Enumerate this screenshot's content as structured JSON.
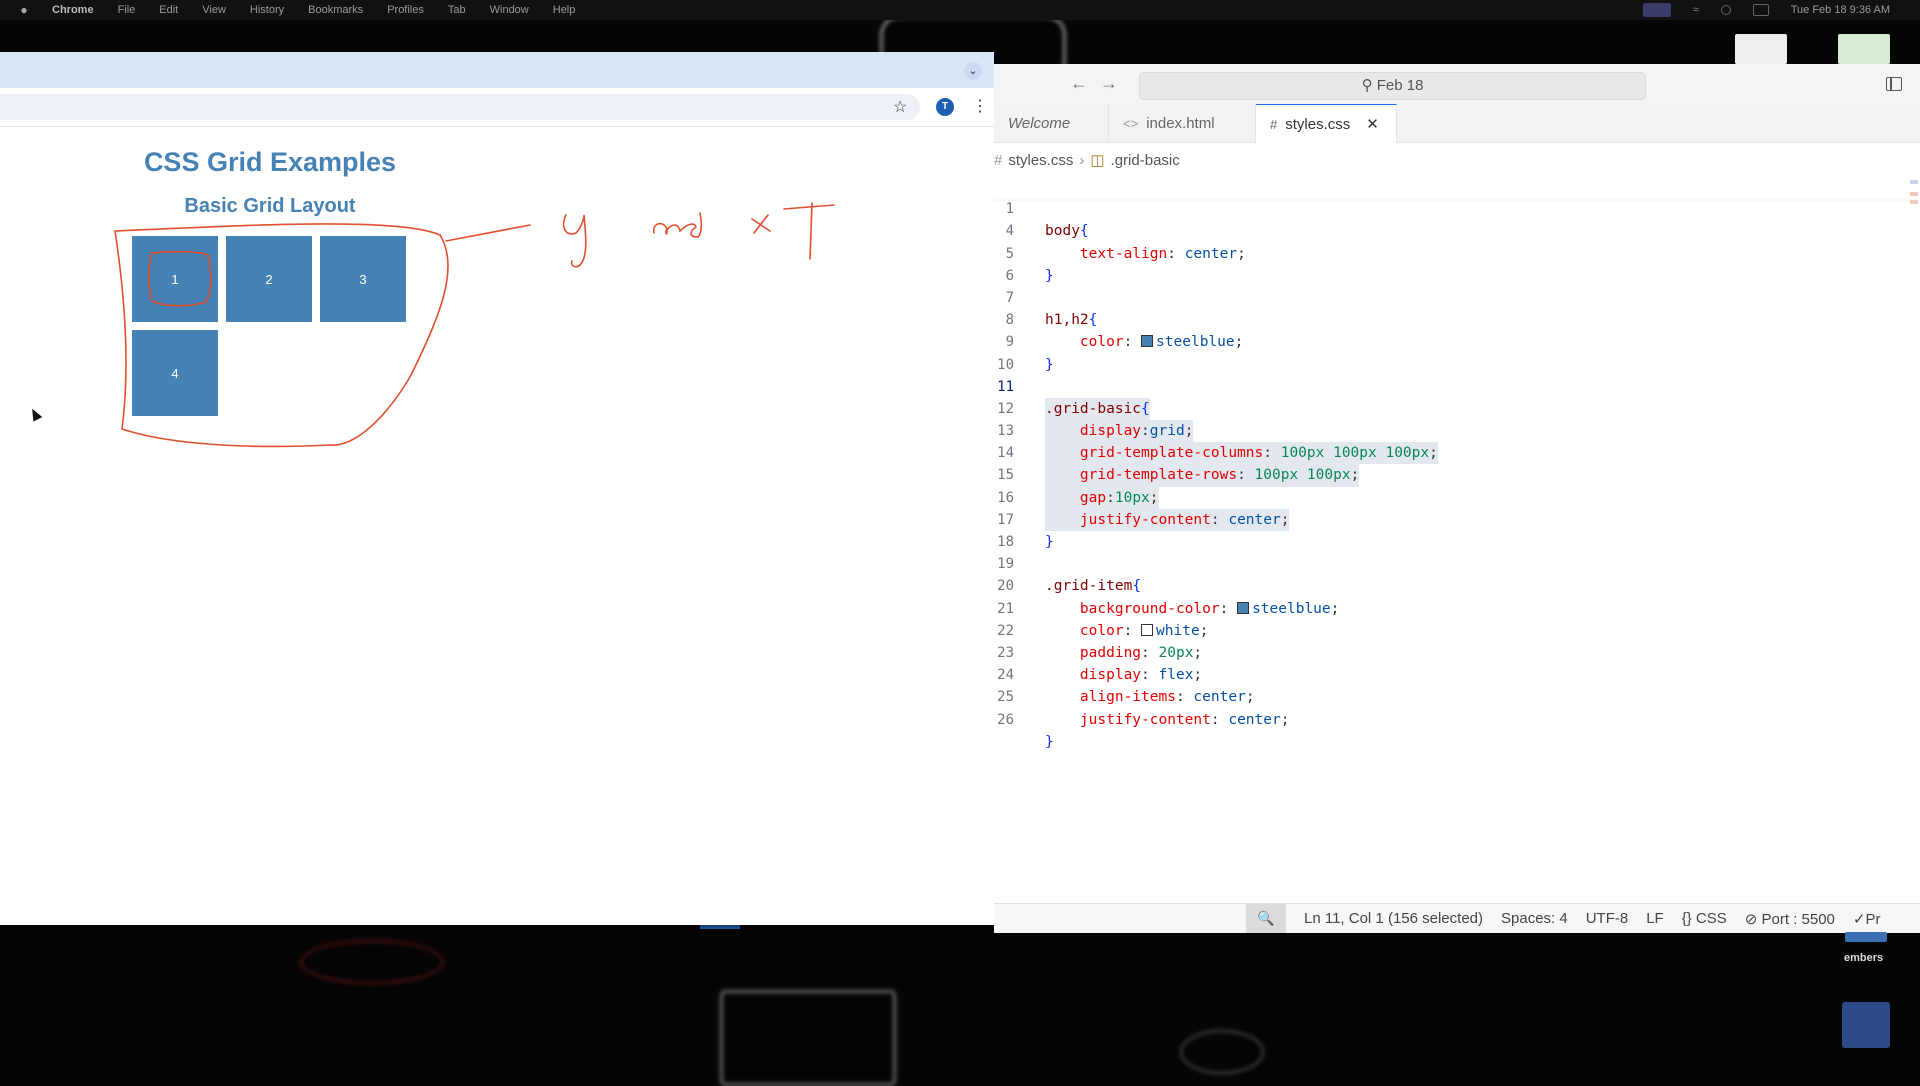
{
  "menubar": {
    "app": "Chrome",
    "items": [
      "File",
      "Edit",
      "View",
      "History",
      "Bookmarks",
      "Profiles",
      "Tab",
      "Window",
      "Help"
    ],
    "clock": "Tue Feb 18  9:36 AM"
  },
  "browser": {
    "avatar_letter": "T",
    "page": {
      "title": "CSS Grid Examples",
      "subtitle": "Basic Grid Layout",
      "grid_items": [
        "1",
        "2",
        "3",
        "4"
      ]
    },
    "annotation_text": "y and x T"
  },
  "editor": {
    "search_text": "Feb 18",
    "tabs": [
      {
        "label": "Welcome",
        "icon": "vscode-icon",
        "active": false
      },
      {
        "label": "index.html",
        "icon": "html-icon",
        "glyph": "<>",
        "active": false
      },
      {
        "label": "styles.css",
        "icon": "css-icon",
        "glyph": "#",
        "active": true
      }
    ],
    "breadcrumb": {
      "file": "styles.css",
      "symbol": ".grid-basic"
    },
    "lines": [
      {
        "n": "1",
        "t": "body{"
      },
      {
        "n": "4",
        "t": "    text-align: center;"
      },
      {
        "n": "5",
        "t": "}"
      },
      {
        "n": "6",
        "t": ""
      },
      {
        "n": "7",
        "t": "h1,h2{"
      },
      {
        "n": "8",
        "t": "    color: steelblue;"
      },
      {
        "n": "9",
        "t": "}"
      },
      {
        "n": "10",
        "t": ""
      },
      {
        "n": "11",
        "t": ".grid-basic{"
      },
      {
        "n": "12",
        "t": "    display:grid;"
      },
      {
        "n": "13",
        "t": "    grid-template-columns: 100px 100px 100px;"
      },
      {
        "n": "14",
        "t": "    grid-template-rows: 100px 100px;"
      },
      {
        "n": "15",
        "t": "    gap:10px;"
      },
      {
        "n": "16",
        "t": "    justify-content: center;"
      },
      {
        "n": "17",
        "t": "}"
      },
      {
        "n": "18",
        "t": ""
      },
      {
        "n": "19",
        "t": ".grid-item{"
      },
      {
        "n": "20",
        "t": "    background-color: steelblue;"
      },
      {
        "n": "21",
        "t": "    color: white;"
      },
      {
        "n": "22",
        "t": "    padding: 20px;"
      },
      {
        "n": "23",
        "t": "    display: flex;"
      },
      {
        "n": "24",
        "t": "    align-items: center;"
      },
      {
        "n": "25",
        "t": "    justify-content: center;"
      },
      {
        "n": "26",
        "t": "}"
      }
    ],
    "status": {
      "position": "Ln 11, Col 1 (156 selected)",
      "spaces": "Spaces: 4",
      "encoding": "UTF-8",
      "eol": "LF",
      "language": "CSS",
      "port": "Port : 5500",
      "prettier": "Pr"
    }
  },
  "desktop": {
    "members_label": "embers"
  },
  "colors": {
    "steelblue": "#4682b4",
    "ink": "#e0502e",
    "accent": "#1f6feb"
  }
}
